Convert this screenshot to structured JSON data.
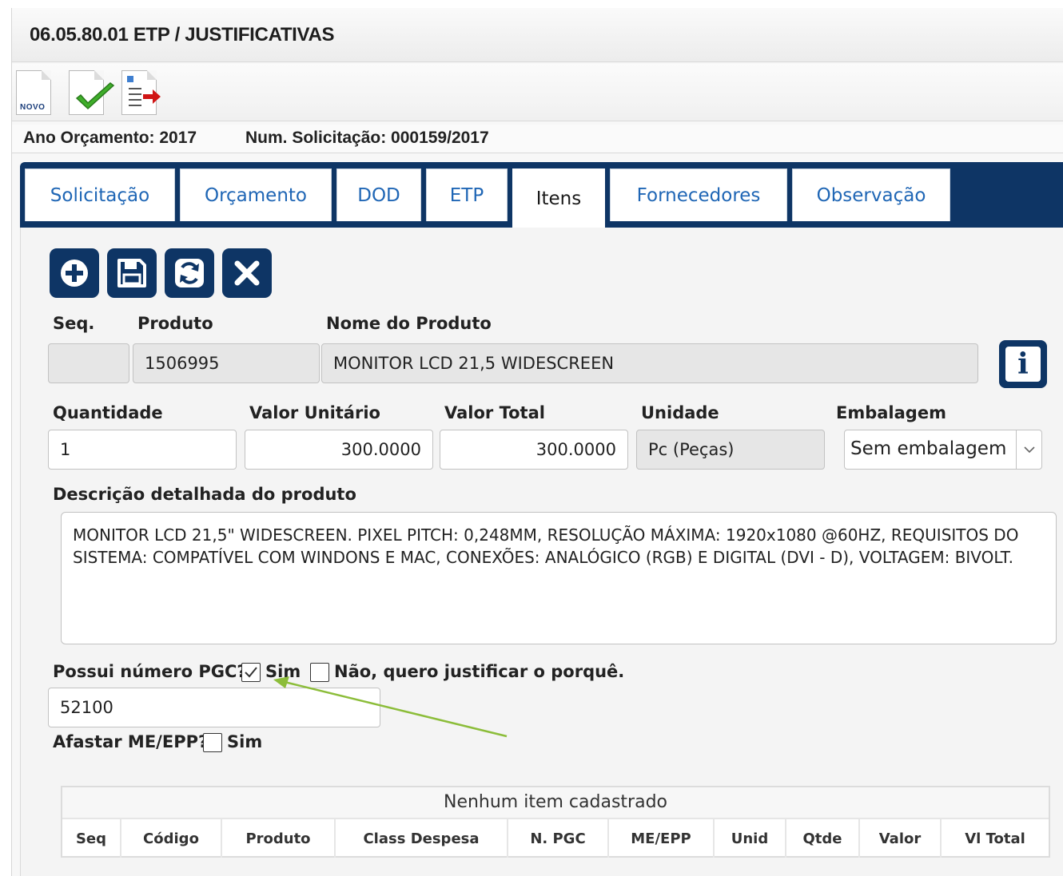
{
  "header": {
    "title": "06.05.80.01 ETP / JUSTIFICATIVAS"
  },
  "toolbar": {
    "novo_label": "NOVO"
  },
  "info": {
    "ano_orcamento": "Ano Orçamento: 2017",
    "num_solicitacao": "Num. Solicitação: 000159/2017"
  },
  "tabs": [
    {
      "label": "Solicitação"
    },
    {
      "label": "Orçamento"
    },
    {
      "label": "DOD"
    },
    {
      "label": "ETP"
    },
    {
      "label": "Itens"
    },
    {
      "label": "Fornecedores"
    },
    {
      "label": "Observação"
    }
  ],
  "active_tab": "Itens",
  "form": {
    "seq_label": "Seq.",
    "seq_value": "",
    "produto_label": "Produto",
    "produto_value": "1506995",
    "nome_label": "Nome do Produto",
    "nome_value": "MONITOR LCD 21,5 WIDESCREEN",
    "quantidade_label": "Quantidade",
    "quantidade_value": "1",
    "valor_unitario_label": "Valor Unitário",
    "valor_unitario_value": "300.0000",
    "valor_total_label": "Valor Total",
    "valor_total_value": "300.0000",
    "unidade_label": "Unidade",
    "unidade_value": "Pc (Peças)",
    "embalagem_label": "Embalagem",
    "embalagem_value": "Sem embalagem",
    "descricao_label": "Descrição detalhada do produto",
    "descricao_value": "MONITOR LCD 21,5\" WIDESCREEN. PIXEL PITCH: 0,248MM, RESOLUÇÃO MÁXIMA: 1920x1080 @60HZ, REQUISITOS DO SISTEMA: COMPATÍVEL COM WINDONS E MAC, CONEXÕES: ANALÓGICO (RGB) E DIGITAL (DVI - D), VOLTAGEM: BIVOLT.",
    "pgc_question": "Possui número PGC?",
    "pgc_sim_label": "Sim",
    "pgc_sim_checked": true,
    "pgc_nao_label": "Não, quero justificar o porquê.",
    "pgc_nao_checked": false,
    "pgc_value": "52100",
    "afastar_label": "Afastar ME/EPP?",
    "afastar_sim_label": "Sim",
    "afastar_checked": false
  },
  "grid": {
    "empty_message": "Nenhum item cadastrado",
    "columns": [
      "Seq",
      "Código",
      "Produto",
      "Class Despesa",
      "N. PGC",
      "ME/EPP",
      "Unid",
      "Qtde",
      "Valor",
      "Vl Total"
    ]
  },
  "colors": {
    "brand_navy": "#0e3565",
    "tab_link": "#1f66b5",
    "annotation_arrow": "#8cbd3a"
  }
}
